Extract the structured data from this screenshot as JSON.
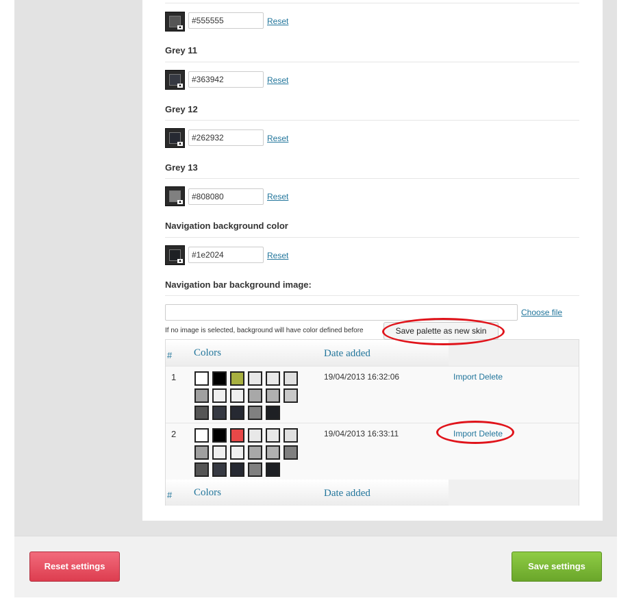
{
  "colors": [
    {
      "label": "",
      "value": "#555555",
      "swatch": "#555555",
      "reset": "Reset"
    },
    {
      "label": "Grey 11",
      "value": "#363942",
      "swatch": "#363942",
      "reset": "Reset"
    },
    {
      "label": "Grey 12",
      "value": "#262932",
      "swatch": "#262932",
      "reset": "Reset"
    },
    {
      "label": "Grey 13",
      "value": "#808080",
      "swatch": "#808080",
      "reset": "Reset"
    },
    {
      "label": "Navigation background color",
      "value": "#1e2024",
      "swatch": "#1e2024",
      "reset": "Reset"
    }
  ],
  "nav_image": {
    "label": "Navigation bar background image:",
    "choose_file": "Choose file",
    "hint": "If no image is selected, background will have color defined before",
    "save_palette": "Save palette as new skin"
  },
  "palette_table": {
    "header": {
      "hash": "#",
      "colors": "Colors",
      "date": "Date added"
    },
    "footer": {
      "hash": "#",
      "colors": "Colors",
      "date": "Date added"
    },
    "rows": [
      {
        "num": "1",
        "date": "19/04/2013 16:32:06",
        "actions": "Import Delete",
        "swatches": [
          "#ffffff",
          "#000000",
          "#a8b040",
          "#e8e8e8",
          "#e8e8e8",
          "#e0e0e0",
          "#a0a0a0",
          "#f0f0f0",
          "#f0f0f0",
          "#a8a8a8",
          "#b0b0b0",
          "#c8c8c8",
          "#555555",
          "#363942",
          "#262932",
          "#808080",
          "#1e2024"
        ]
      },
      {
        "num": "2",
        "date": "19/04/2013 16:33:11",
        "actions": "Import Delete",
        "swatches": [
          "#ffffff",
          "#000000",
          "#e84848",
          "#e8e8e8",
          "#e8e8e8",
          "#e0e0e0",
          "#a0a0a0",
          "#f0f0f0",
          "#f0f0f0",
          "#a8a8a8",
          "#b0b0b0",
          "#808080",
          "#555555",
          "#363942",
          "#262932",
          "#808080",
          "#1e2024"
        ]
      }
    ]
  },
  "footer": {
    "reset_label": "Reset settings",
    "save_label": "Save settings",
    "reset_color": "#e04a5c",
    "save_color": "#7ab836"
  }
}
